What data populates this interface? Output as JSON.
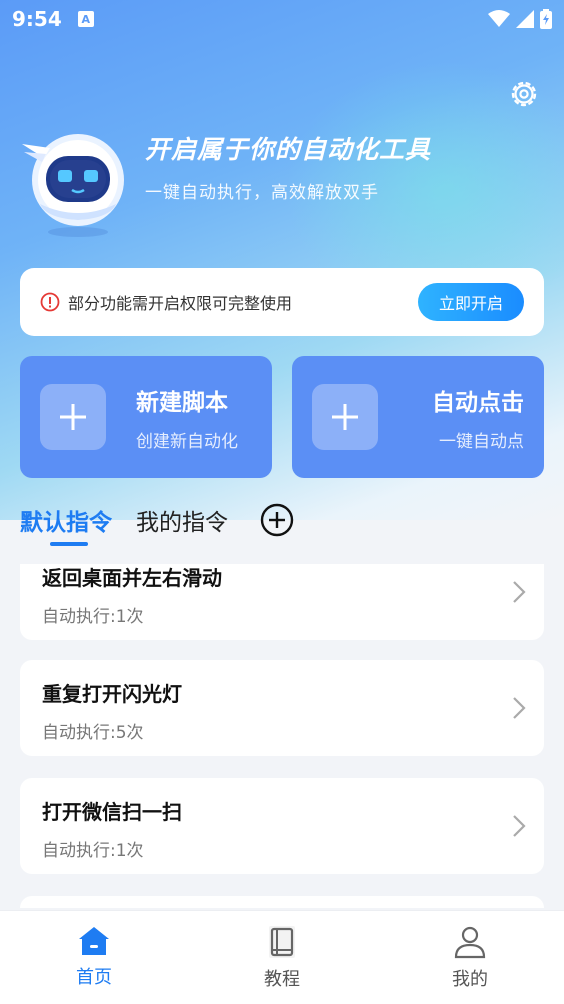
{
  "status": {
    "time": "9:54",
    "notif_letter": "A"
  },
  "hero": {
    "title": "开启属于你的自动化工具",
    "subtitle": "一键自动执行，高效解放双手"
  },
  "permission": {
    "text": "部分功能需开启权限可完整使用",
    "button": "立即开启"
  },
  "actions": [
    {
      "title": "新建脚本",
      "subtitle": "创建新自动化"
    },
    {
      "title": "自动点击",
      "subtitle": "一键自动点"
    }
  ],
  "tabs": [
    {
      "label": "默认指令",
      "active": true
    },
    {
      "label": "我的指令",
      "active": false
    }
  ],
  "commands": [
    {
      "title": "返回桌面并左右滑动",
      "count": "自动执行:1次"
    },
    {
      "title": "重复打开闪光灯",
      "count": "自动执行:5次"
    },
    {
      "title": "打开微信扫一扫",
      "count": "自动执行:1次"
    }
  ],
  "nav": [
    {
      "label": "首页",
      "icon": "home-icon",
      "active": true
    },
    {
      "label": "教程",
      "icon": "book-icon",
      "active": false
    },
    {
      "label": "我的",
      "icon": "user-icon",
      "active": false
    }
  ],
  "colors": {
    "accent": "#1e7cf2",
    "card_blue": "#5b8ff5",
    "warning": "#e53935"
  }
}
